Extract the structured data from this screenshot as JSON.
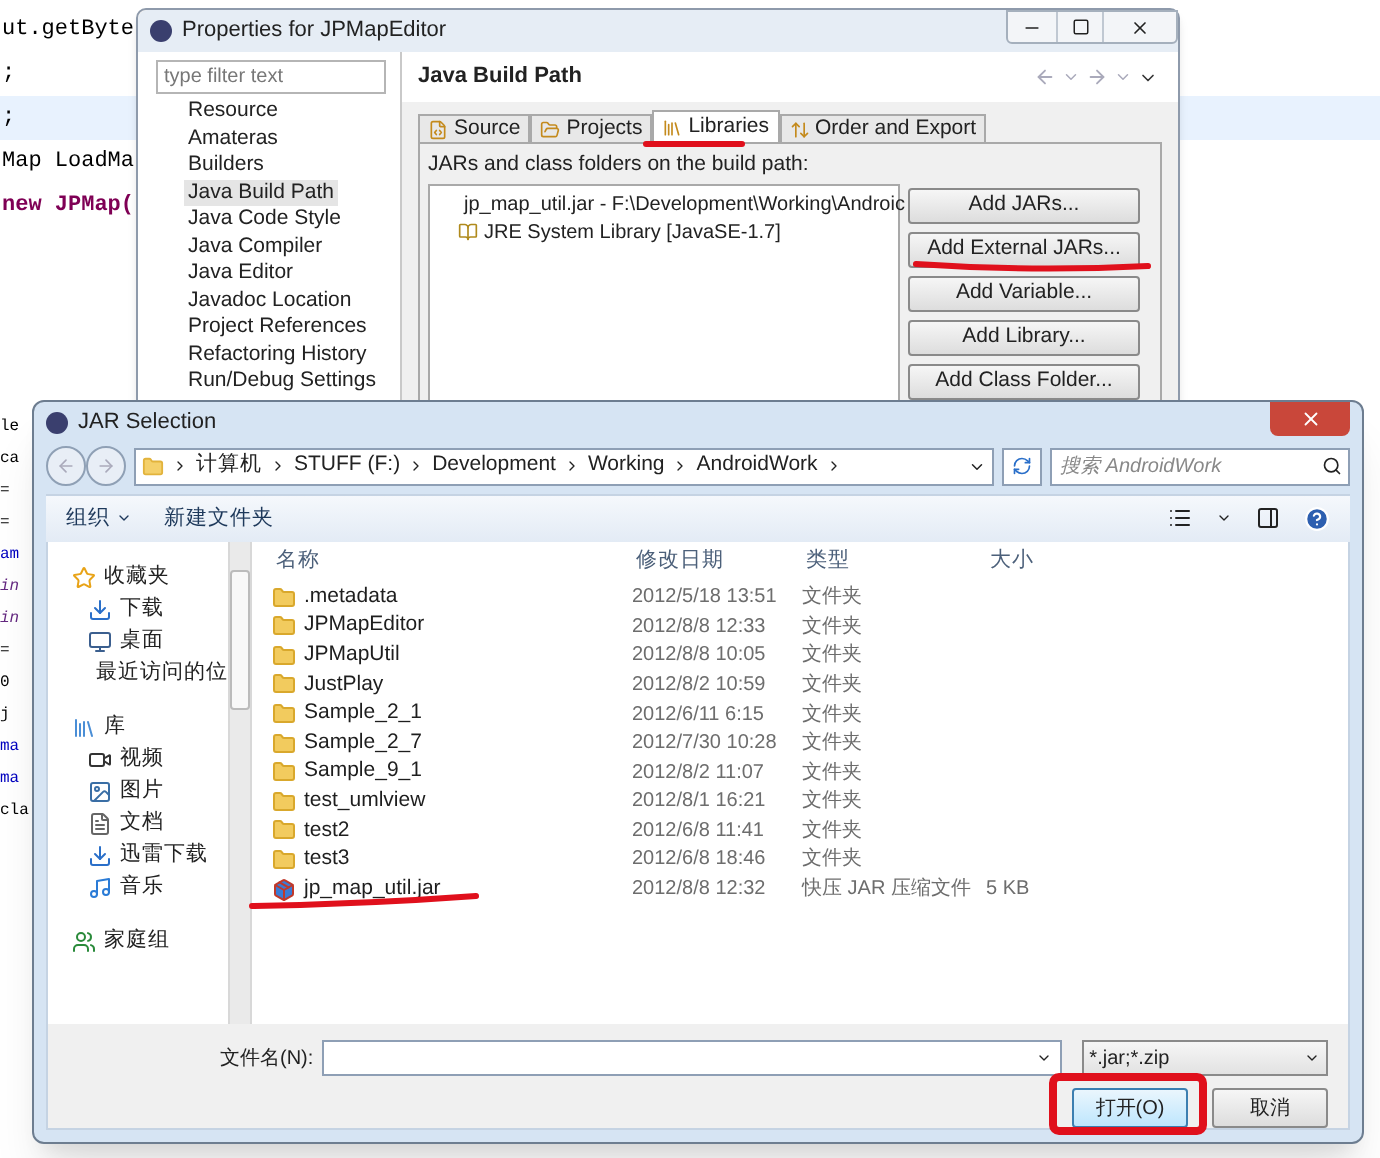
{
  "editor": {
    "top_lines": [
      {
        "text": "ut.getByte",
        "kind": "plain",
        "highlighted": false
      },
      {
        "text": ";",
        "kind": "plain",
        "highlighted": false
      },
      {
        "text": ";",
        "kind": "plain",
        "highlighted": true
      },
      {
        "text": "Map LoadMa",
        "kind": "plain",
        "highlighted": false
      },
      {
        "text": "new JPMap(",
        "kind": "keyword",
        "highlighted": false
      }
    ],
    "side_lines": [
      {
        "text": "le",
        "kind": "plain"
      },
      {
        "text": "ca",
        "kind": "plain"
      },
      {
        "text": "=",
        "kind": "plain"
      },
      {
        "text": "=",
        "kind": "plain"
      },
      {
        "text": "am",
        "kind": "field"
      },
      {
        "text": "in",
        "kind": "italic"
      },
      {
        "text": "in",
        "kind": "italic"
      },
      {
        "text": "=",
        "kind": "plain"
      },
      {
        "text": "0",
        "kind": "plain"
      },
      {
        "text": "j",
        "kind": "plain"
      },
      {
        "text": "ma",
        "kind": "field"
      },
      {
        "text": "ma",
        "kind": "field"
      },
      {
        "text": "cla",
        "kind": "plain"
      }
    ]
  },
  "properties_window": {
    "title": "Properties for JPMapEditor",
    "filter": {
      "placeholder": "type filter text"
    },
    "nav_items": [
      {
        "label": "Resource",
        "selected": false
      },
      {
        "label": "Amateras",
        "selected": false
      },
      {
        "label": "Builders",
        "selected": false
      },
      {
        "label": "Java Build Path",
        "selected": true
      },
      {
        "label": "Java Code Style",
        "selected": false
      },
      {
        "label": "Java Compiler",
        "selected": false
      },
      {
        "label": "Java Editor",
        "selected": false
      },
      {
        "label": "Javadoc Location",
        "selected": false
      },
      {
        "label": "Project References",
        "selected": false
      },
      {
        "label": "Refactoring History",
        "selected": false
      },
      {
        "label": "Run/Debug Settings",
        "selected": false
      }
    ],
    "page_title": "Java Build Path",
    "tabs": [
      {
        "label": "Source",
        "kind": "source",
        "selected": false
      },
      {
        "label": "Projects",
        "kind": "projects",
        "selected": false
      },
      {
        "label": "Libraries",
        "kind": "libraries",
        "selected": true
      },
      {
        "label": "Order and Export",
        "kind": "order",
        "selected": false
      }
    ],
    "list_label": "JARs and class folders on the build path:",
    "entries": [
      {
        "label": "jp_map_util.jar - F:\\Development\\Working\\Androic",
        "kind": "jar"
      },
      {
        "label": "JRE System Library [JavaSE-1.7]",
        "kind": "library"
      }
    ],
    "buttons": [
      "Add JARs...",
      "Add External JARs...",
      "Add Variable...",
      "Add Library...",
      "Add Class Folder..."
    ]
  },
  "jar_dialog": {
    "title": "JAR Selection",
    "breadcrumb": [
      "计算机",
      "STUFF (F:)",
      "Development",
      "Working",
      "AndroidWork"
    ],
    "search": {
      "placeholder": "搜索 AndroidWork"
    },
    "toolbar": [
      {
        "label": "组织",
        "kind": "menu"
      },
      {
        "label": "新建文件夹",
        "kind": "plain"
      }
    ],
    "sidebar": [
      {
        "label": "收藏夹",
        "kind": "star",
        "children": [
          {
            "label": "下载",
            "kind": "download"
          },
          {
            "label": "桌面",
            "kind": "desktop"
          },
          {
            "label": "最近访问的位",
            "kind": "recent"
          }
        ]
      },
      {
        "label": "库",
        "kind": "library",
        "children": [
          {
            "label": "视频",
            "kind": "video"
          },
          {
            "label": "图片",
            "kind": "image"
          },
          {
            "label": "文档",
            "kind": "document"
          },
          {
            "label": "迅雷下载",
            "kind": "download"
          },
          {
            "label": "音乐",
            "kind": "music"
          }
        ]
      },
      {
        "label": "家庭组",
        "kind": "homegroup"
      }
    ],
    "columns": [
      "名称",
      "修改日期",
      "类型",
      "大小"
    ],
    "rows": [
      {
        "name": ".metadata",
        "date": "2012/5/18 13:51",
        "type": "文件夹",
        "kind": "folder"
      },
      {
        "name": "JPMapEditor",
        "date": "2012/8/8 12:33",
        "type": "文件夹",
        "kind": "folder"
      },
      {
        "name": "JPMapUtil",
        "date": "2012/8/8 10:05",
        "type": "文件夹",
        "kind": "folder"
      },
      {
        "name": "JustPlay",
        "date": "2012/8/2 10:59",
        "type": "文件夹",
        "kind": "folder"
      },
      {
        "name": "Sample_2_1",
        "date": "2012/6/11 6:15",
        "type": "文件夹",
        "kind": "folder"
      },
      {
        "name": "Sample_2_7",
        "date": "2012/7/30 10:28",
        "type": "文件夹",
        "kind": "folder"
      },
      {
        "name": "Sample_9_1",
        "date": "2012/8/2 11:07",
        "type": "文件夹",
        "kind": "folder"
      },
      {
        "name": "test_umlview",
        "date": "2012/8/1 16:21",
        "type": "文件夹",
        "kind": "folder"
      },
      {
        "name": "test2",
        "date": "2012/6/8 11:41",
        "type": "文件夹",
        "kind": "folder"
      },
      {
        "name": "test3",
        "date": "2012/6/8 18:46",
        "type": "文件夹",
        "kind": "folder"
      },
      {
        "name": "jp_map_util.jar",
        "date": "2012/8/8 12:32",
        "type": "快压 JAR 压缩文件",
        "size": "5 KB",
        "kind": "jar"
      }
    ],
    "filename_label": "文件名(N):",
    "filter": "*.jar;*.zip",
    "buttons": [
      "打开(O)",
      "取消"
    ]
  }
}
